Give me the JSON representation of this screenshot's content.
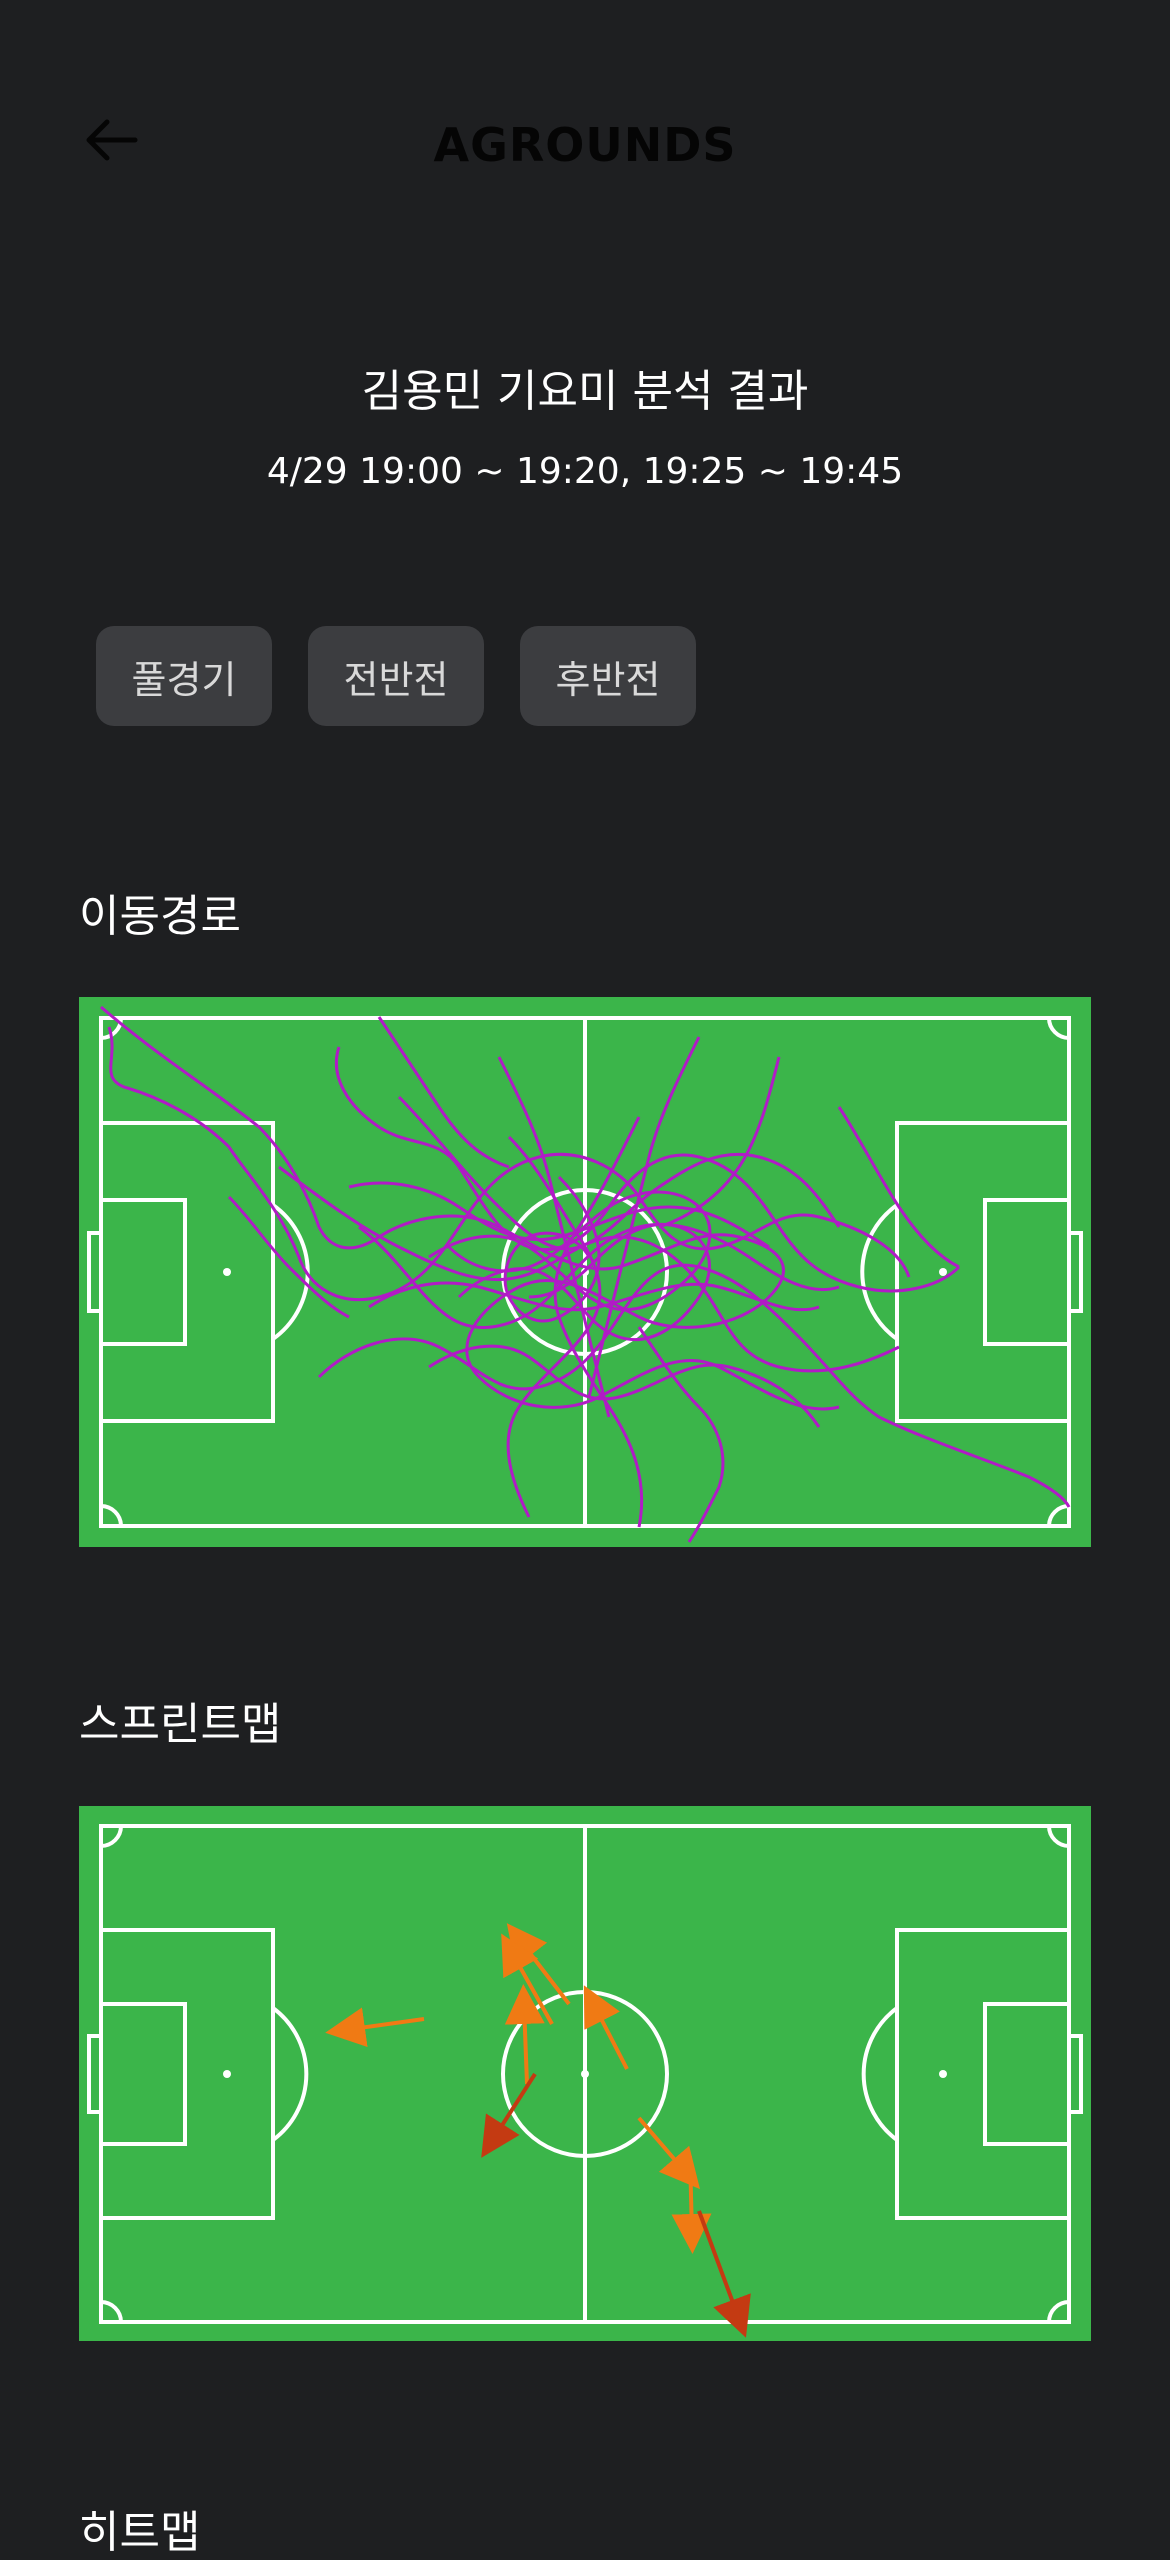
{
  "header": {
    "title": "AGROUNDS",
    "back_icon": "arrow-left-icon"
  },
  "analysis": {
    "title": "김용민 기요미 분석 결과",
    "time": "4/29 19:00 ~ 19:20, 19:25 ~ 19:45"
  },
  "tabs": [
    {
      "label": "풀경기"
    },
    {
      "label": "전반전"
    },
    {
      "label": "후반전"
    }
  ],
  "sections": {
    "path": {
      "title": "이동경로"
    },
    "sprint": {
      "title": "스프린트맵"
    },
    "heatmap": {
      "title": "히트맵"
    }
  },
  "colors": {
    "background": "#1e1f21",
    "tab_background": "#3c3d40",
    "pitch_green": "#3bb54a",
    "pitch_lines": "#ffffff",
    "path_line": "#b11bc6",
    "sprint_orange": "#f07a14",
    "sprint_red": "#c43a12"
  }
}
